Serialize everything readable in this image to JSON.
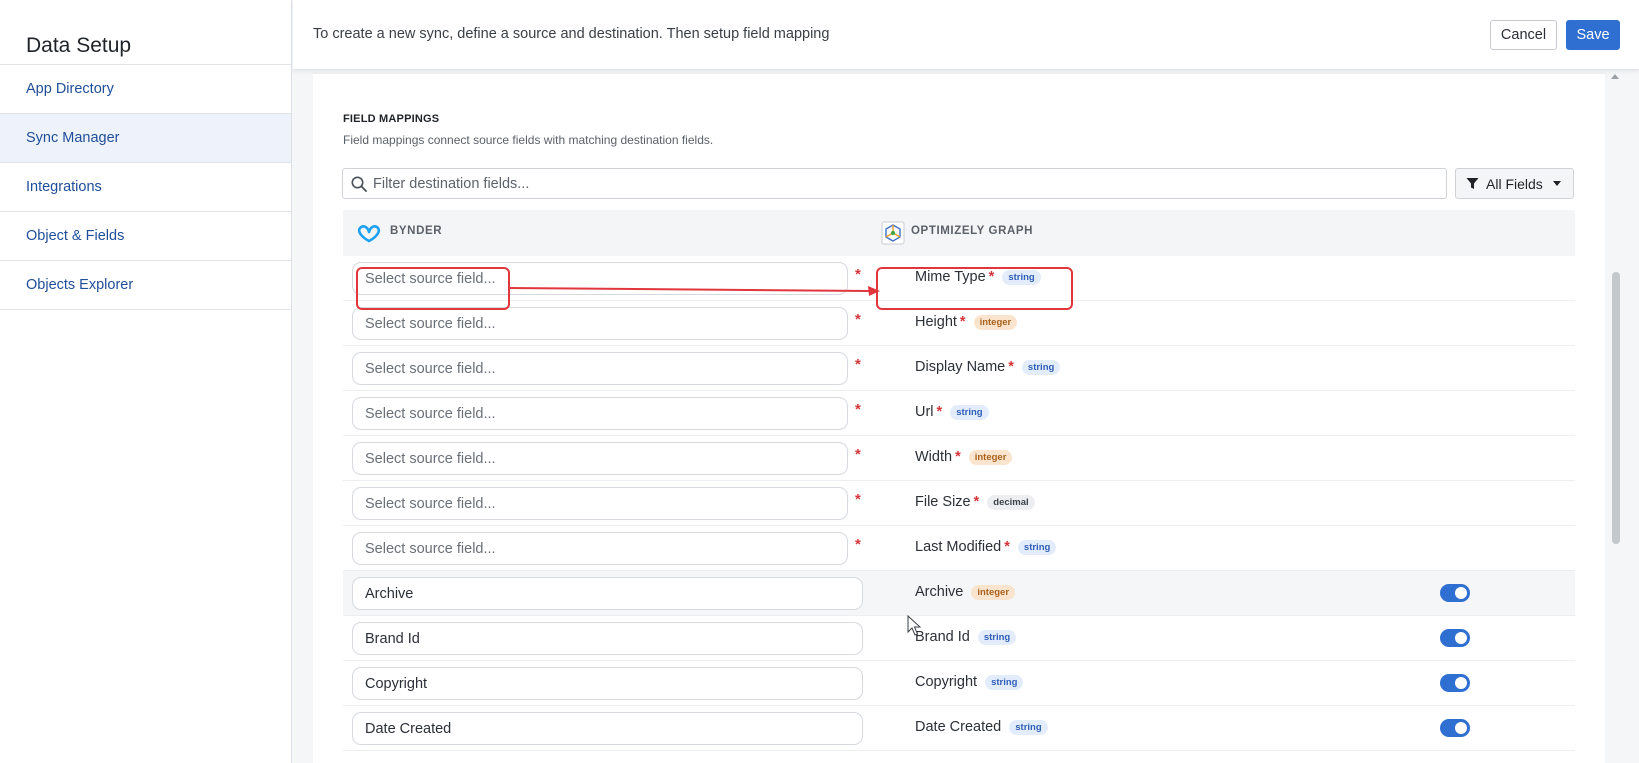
{
  "sidebar": {
    "title": "Data Setup",
    "items": [
      {
        "label": "App Directory"
      },
      {
        "label": "Sync Manager"
      },
      {
        "label": "Integrations"
      },
      {
        "label": "Object & Fields"
      },
      {
        "label": "Objects Explorer"
      }
    ]
  },
  "header": {
    "instruction": "To create a new sync, define a source and destination. Then setup field mapping",
    "cancel_label": "Cancel",
    "save_label": "Save"
  },
  "field_mappings": {
    "title": "FIELD MAPPINGS",
    "description": "Field mappings connect source fields with matching destination fields.",
    "filter_placeholder": "Filter destination fields...",
    "filter_value": "",
    "filter_dropdown_label": "All Fields",
    "source_header": "BYNDER",
    "destination_header": "OPTIMIZELY GRAPH",
    "rows": [
      {
        "source": "Select source field...",
        "source_set": false,
        "required": true,
        "dest": "Mime Type",
        "type": "string",
        "toggle": false
      },
      {
        "source": "Select source field...",
        "source_set": false,
        "required": true,
        "dest": "Height",
        "type": "integer",
        "toggle": false
      },
      {
        "source": "Select source field...",
        "source_set": false,
        "required": true,
        "dest": "Display Name",
        "type": "string",
        "toggle": false
      },
      {
        "source": "Select source field...",
        "source_set": false,
        "required": true,
        "dest": "Url",
        "type": "string",
        "toggle": false
      },
      {
        "source": "Select source field...",
        "source_set": false,
        "required": true,
        "dest": "Width",
        "type": "integer",
        "toggle": false
      },
      {
        "source": "Select source field...",
        "source_set": false,
        "required": true,
        "dest": "File Size",
        "type": "decimal",
        "toggle": false
      },
      {
        "source": "Select source field...",
        "source_set": false,
        "required": true,
        "dest": "Last Modified",
        "type": "string",
        "toggle": false
      },
      {
        "source": "Archive",
        "source_set": true,
        "required": false,
        "dest": "Archive",
        "type": "integer",
        "toggle": true
      },
      {
        "source": "Brand Id",
        "source_set": true,
        "required": false,
        "dest": "Brand Id",
        "type": "string",
        "toggle": true
      },
      {
        "source": "Copyright",
        "source_set": true,
        "required": false,
        "dest": "Copyright",
        "type": "string",
        "toggle": true
      },
      {
        "source": "Date Created",
        "source_set": true,
        "required": false,
        "dest": "Date Created",
        "type": "string",
        "toggle": true
      }
    ],
    "required_mark": "*"
  },
  "colors": {
    "accent": "#2f6fd1",
    "annotation": "#e0363c",
    "nav_link": "#1f4e9a"
  },
  "icons": {
    "search": "search-icon",
    "filter": "filter-icon",
    "caret": "chevron-down-icon",
    "source_logo": "bynder-logo-icon",
    "destination_logo": "optimizely-graph-logo-icon"
  }
}
